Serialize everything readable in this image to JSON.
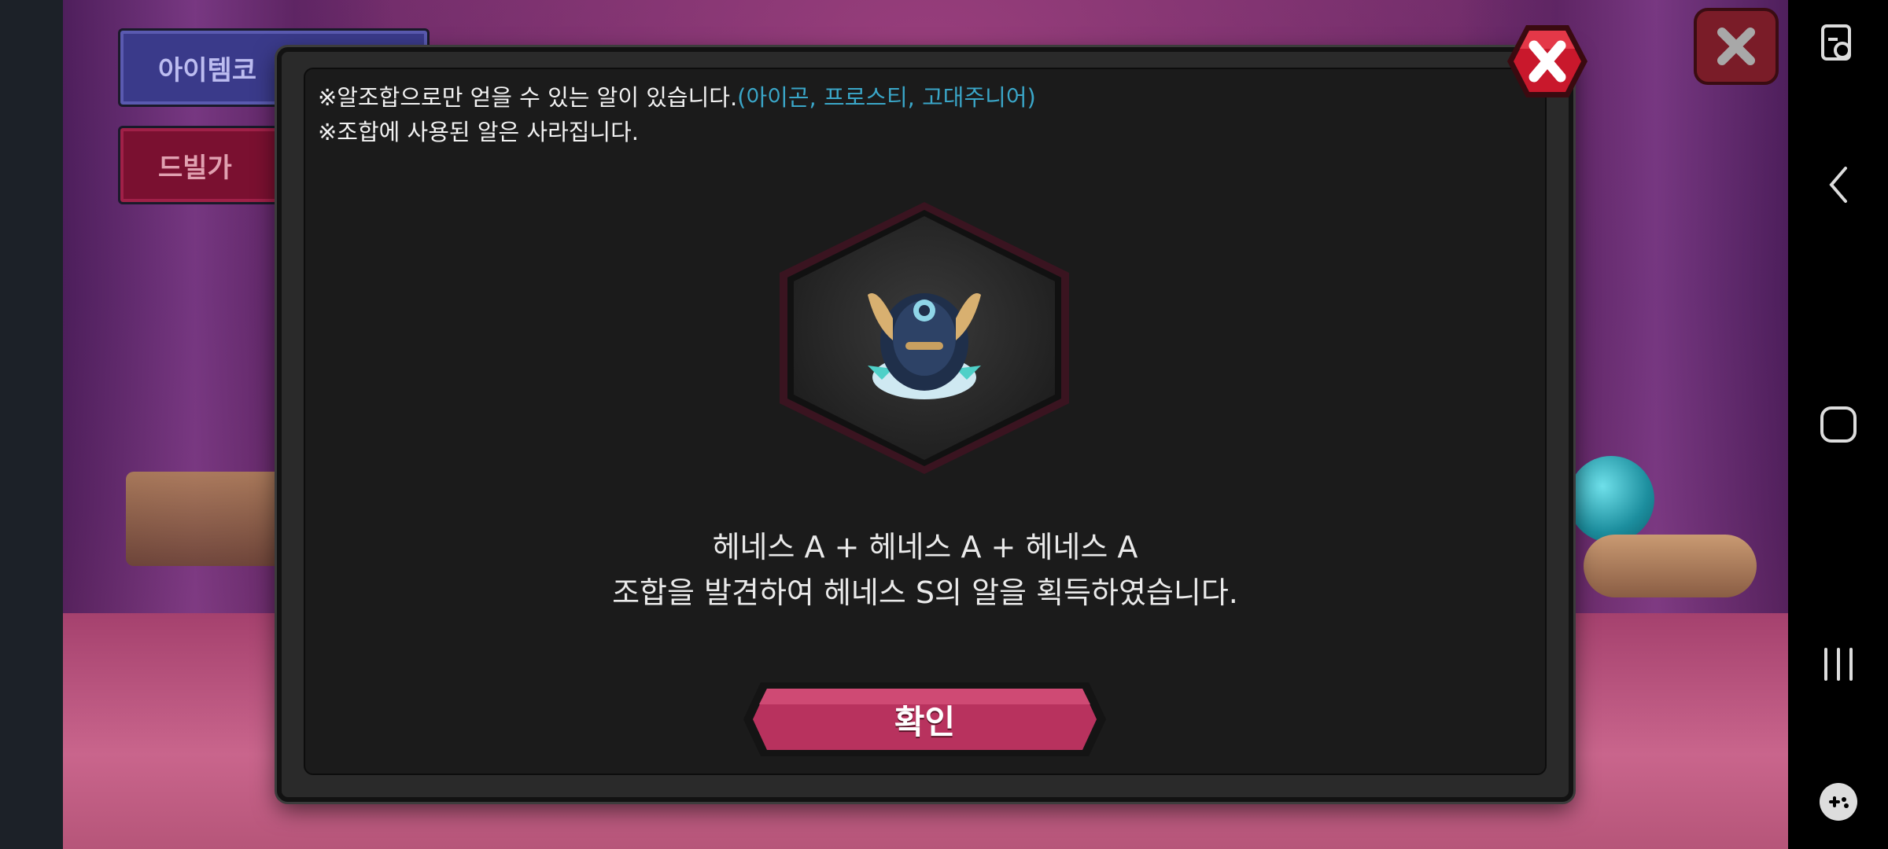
{
  "background_buttons": {
    "item_code_label": "아이템코",
    "dribble_label": "드빌가"
  },
  "modal": {
    "note_line1": "※알조합으로만 얻을 수 있는 알이 있습니다.",
    "note_line1_highlight": "(아이곤, 프로스티, 고대주니어)",
    "note_line2": "※조합에 사용된 알은 사라집니다.",
    "result_line1": "헤네스 A + 헤네스 A + 헤네스 A",
    "result_line2": "조합을 발견하여 헤네스 S의 알을 획득하였습니다.",
    "confirm_label": "확인",
    "egg_icon": "henes-s-egg-icon"
  },
  "navbar": {
    "icons": [
      "screen-lock-icon",
      "back-icon",
      "home-icon",
      "recents-icon",
      "game-tools-icon"
    ]
  },
  "colors": {
    "highlight": "#3aa6c8",
    "confirm_button": "#b8325e",
    "close_button": "#c9182c"
  }
}
